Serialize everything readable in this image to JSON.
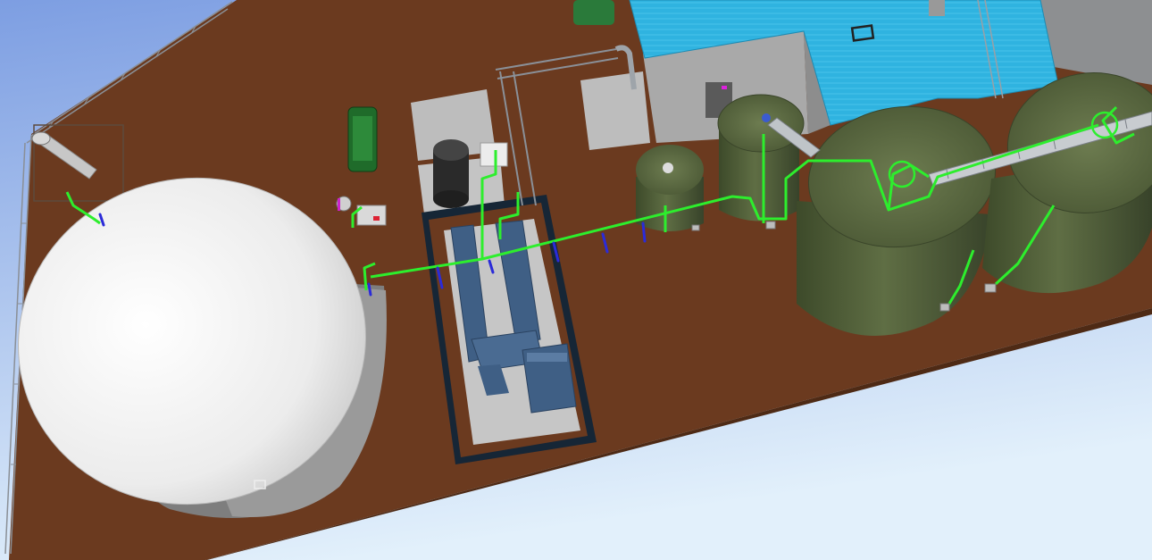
{
  "scene": {
    "type": "3d-plant-model-render",
    "colors": {
      "sky_top": "#7d9ee2",
      "sky_bottom": "#e2f0fb",
      "ground": "#6b3a1f",
      "slab": "#bdbdbd",
      "dome": "#f2f2f2",
      "tank": "#5f6e44",
      "tank_dark": "#3d4a2a",
      "roof": "#2fb3e0",
      "wall": "#a9a9a9",
      "pipe": "#2dee2d",
      "valve": "#2b2bd8",
      "equipment": "#3f5f85",
      "frame": "#0f1f33",
      "railing": "#7a7f86"
    },
    "objects": [
      {
        "id": "perimeter-railing",
        "icon": "railing-icon"
      },
      {
        "id": "digester-dome",
        "icon": "dome-icon"
      },
      {
        "id": "stack-pipe",
        "icon": "pipe-icon"
      },
      {
        "id": "chp-skid",
        "icon": "generator-icon"
      },
      {
        "id": "black-vessel",
        "icon": "tank-icon"
      },
      {
        "id": "small-tank",
        "icon": "tank-icon"
      },
      {
        "id": "mid-tank",
        "icon": "tank-icon"
      },
      {
        "id": "large-tank-1",
        "icon": "silo-icon"
      },
      {
        "id": "large-tank-2",
        "icon": "silo-icon"
      },
      {
        "id": "main-building",
        "icon": "building-icon"
      },
      {
        "id": "conveyor-bridge",
        "icon": "conveyor-icon"
      },
      {
        "id": "gas-pipeline",
        "icon": "pipe-icon"
      }
    ]
  }
}
